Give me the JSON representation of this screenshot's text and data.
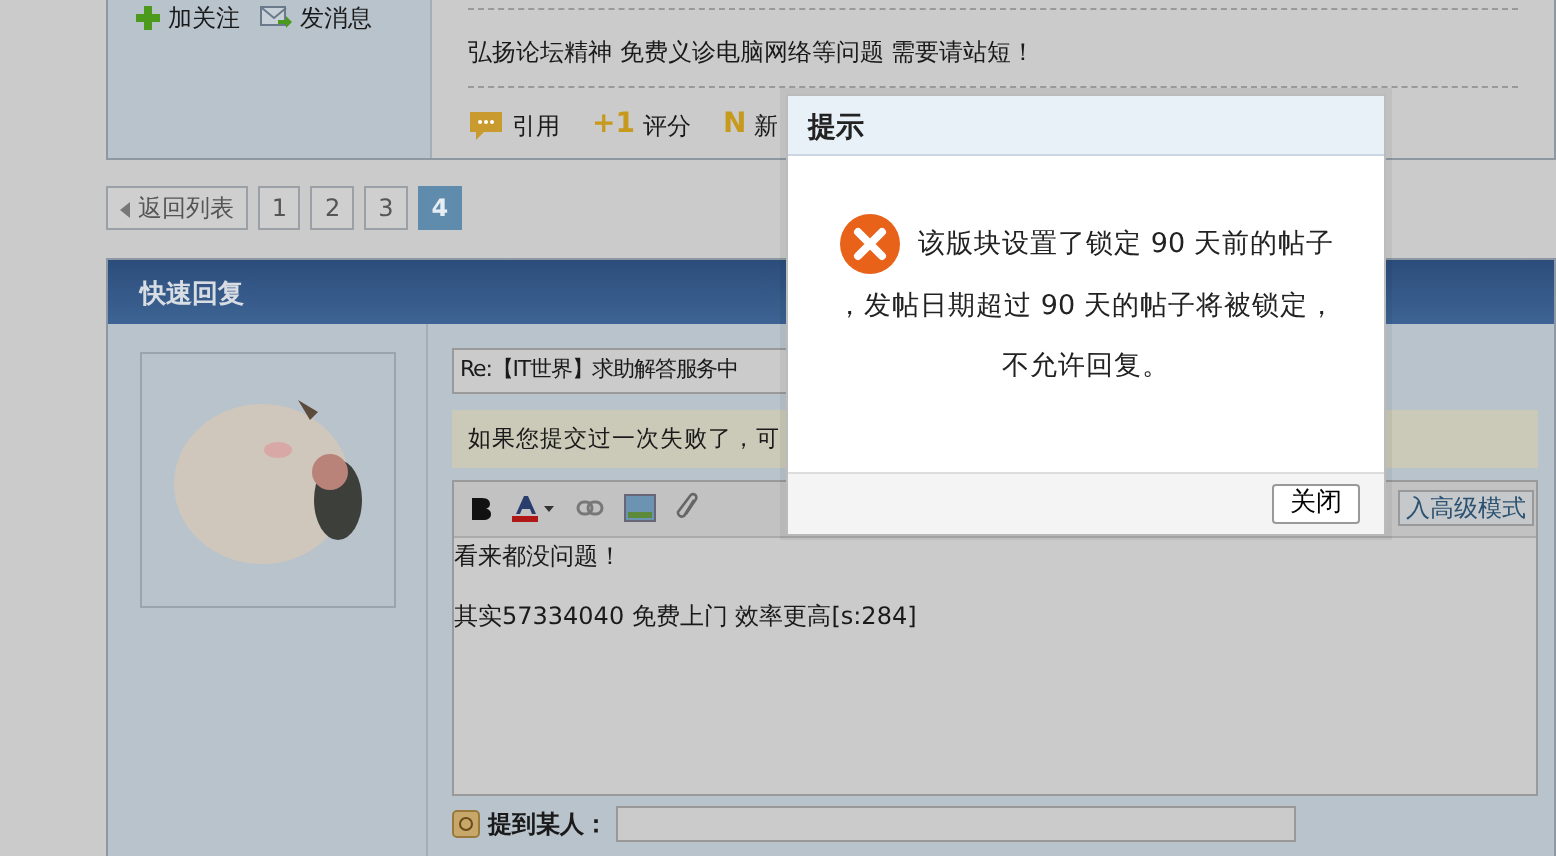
{
  "post": {
    "author_actions": [
      {
        "kind": "follow",
        "label": "加关注"
      },
      {
        "kind": "message",
        "label": "发消息"
      }
    ],
    "signature": "弘扬论坛精神 免费义诊电脑网络等问题 需要请站短！",
    "actions": [
      {
        "kind": "quote",
        "label": "引用"
      },
      {
        "kind": "rate",
        "badge": "+1",
        "label": "评分"
      },
      {
        "kind": "new",
        "badge": "N",
        "label": "新"
      }
    ]
  },
  "pagination": {
    "back": "返回列表",
    "pages": [
      {
        "label": "1",
        "selected": false
      },
      {
        "label": "2",
        "selected": false
      },
      {
        "label": "3",
        "selected": false
      },
      {
        "label": "4",
        "selected": true
      }
    ]
  },
  "quick_reply": {
    "title": "快速回复",
    "subject": "Re:【IT世界】求助解答服务中",
    "notice": "如果您提交过一次失败了，可",
    "advanced_mode": "入高级模式",
    "editor_lines": [
      "看来都没问题！",
      "其实57334040  免费上门  效率更高[s:284]"
    ],
    "mention_label": "提到某人："
  },
  "dialog": {
    "title": "提示",
    "message_lines": [
      "该版块设置了锁定 90 天前的帖子",
      "，发帖日期超过 90 天的帖子将被锁定，",
      "不允许回复。"
    ],
    "close": "关闭"
  }
}
